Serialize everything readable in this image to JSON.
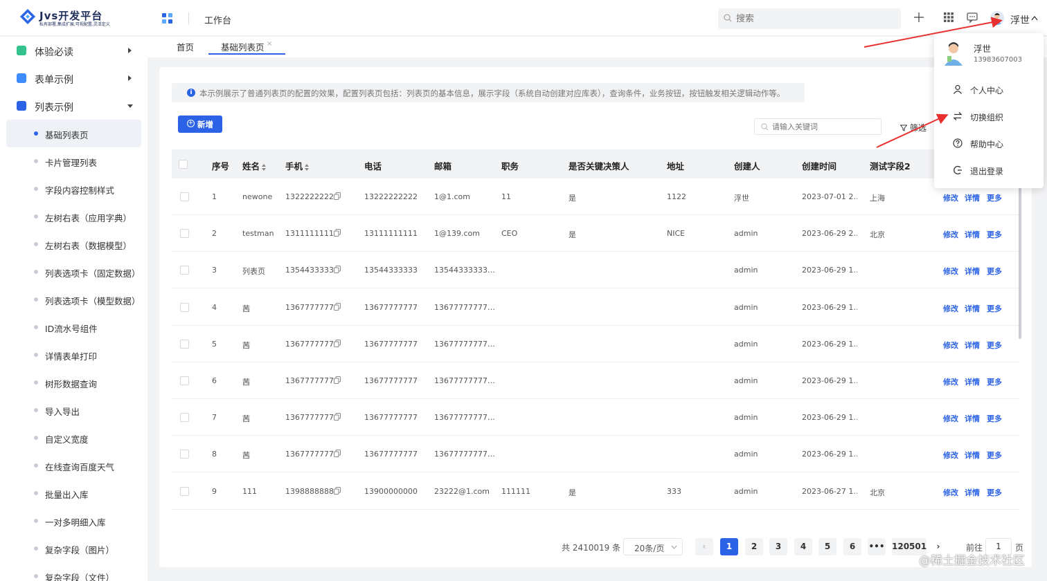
{
  "header": {
    "logo_title": "Jvs开发平台",
    "logo_subtitle": "私有部署,集成扩展,可视配置,灵活定义",
    "workspace_label": "工作台",
    "search_placeholder": "搜索",
    "user_name": "浮世"
  },
  "sidebar": {
    "groups": [
      {
        "label": "体验必读",
        "icon_color": "#34c38f",
        "expanded": false
      },
      {
        "label": "表单示例",
        "icon_color": "#3f8cff",
        "expanded": false
      },
      {
        "label": "列表示例",
        "icon_color": "#2c63e6",
        "expanded": true
      }
    ],
    "items": [
      {
        "label": "基础列表页",
        "active": true
      },
      {
        "label": "卡片管理列表"
      },
      {
        "label": "字段内容控制样式"
      },
      {
        "label": "左树右表（应用字典）"
      },
      {
        "label": "左树右表（数据模型）"
      },
      {
        "label": "列表选项卡（固定数据）"
      },
      {
        "label": "列表选项卡（模型数据）"
      },
      {
        "label": "ID流水号组件"
      },
      {
        "label": "详情表单打印"
      },
      {
        "label": "树形数据查询"
      },
      {
        "label": "导入导出"
      },
      {
        "label": "自定义宽度"
      },
      {
        "label": "在线查询百度天气"
      },
      {
        "label": "批量出入库"
      },
      {
        "label": "一对多明细入库"
      },
      {
        "label": "复杂字段（图片）"
      },
      {
        "label": "复杂字段（文件）"
      }
    ]
  },
  "tabs": [
    {
      "label": "首页"
    },
    {
      "label": "基础列表页",
      "active": true,
      "close": "×"
    }
  ],
  "notice": "本示例展示了普通列表页的配置的效果，配置列表页包括：列表页的基本信息，展示字段（系统自动创建对应库表），查询条件，业务按钮，按钮触发相关逻辑动作等。",
  "toolbar": {
    "new_label": "新增",
    "keyword_placeholder": "请输入关键词",
    "filter_label": "筛选"
  },
  "table": {
    "columns": [
      "序号",
      "姓名",
      "手机",
      "电话",
      "邮箱",
      "职务",
      "是否关键决策人",
      "地址",
      "创建人",
      "创建时间",
      "测试字段2"
    ],
    "actions": [
      "修改",
      "详情",
      "更多"
    ],
    "rows": [
      [
        "1",
        "newone",
        "13222222222",
        "13222222222",
        "1@1.com",
        "11",
        "是",
        "1122",
        "浮世",
        "2023-07-01 2…",
        "上海"
      ],
      [
        "2",
        "testman",
        "13111111111",
        "13111111111",
        "1@139.com",
        "CEO",
        "是",
        "NICE",
        "admin",
        "2023-06-29 2…",
        "北京"
      ],
      [
        "3",
        "列表页",
        "13544333333",
        "13544333333",
        "13544333333…",
        "",
        "",
        "",
        "admin",
        "2023-06-29 1…",
        ""
      ],
      [
        "4",
        "茜",
        "13677777777",
        "13677777777",
        "13677777777…",
        "",
        "",
        "",
        "admin",
        "2023-06-29 1…",
        ""
      ],
      [
        "5",
        "茜",
        "13677777777",
        "13677777777",
        "13677777777…",
        "",
        "",
        "",
        "admin",
        "2023-06-29 1…",
        ""
      ],
      [
        "6",
        "茜",
        "13677777777",
        "13677777777",
        "13677777777…",
        "",
        "",
        "",
        "admin",
        "2023-06-29 1…",
        ""
      ],
      [
        "7",
        "茜",
        "13677777777",
        "13677777777",
        "13677777777…",
        "",
        "",
        "",
        "admin",
        "2023-06-29 1…",
        ""
      ],
      [
        "8",
        "茜",
        "13677777777",
        "13677777777",
        "13677777777…",
        "",
        "",
        "",
        "admin",
        "2023-06-29 1…",
        ""
      ],
      [
        "9",
        "111",
        "13988888888",
        "13900000000",
        "23222@1.com",
        "111111",
        "是",
        "333",
        "admin",
        "2023-06-27 1…",
        "北京"
      ]
    ]
  },
  "pagination": {
    "total": "共 2410019 条",
    "page_size": "20条/页",
    "pages": [
      "1",
      "2",
      "3",
      "4",
      "5",
      "6",
      "•••",
      "120501"
    ],
    "current": "1",
    "goto_label": "前往",
    "goto_value": "1",
    "page_label": "页"
  },
  "user_menu": {
    "name": "浮世",
    "phone": "13983607003",
    "items": [
      {
        "label": "个人中心",
        "icon": "user-icon"
      },
      {
        "label": "切换组织",
        "icon": "switch-icon"
      },
      {
        "label": "帮助中心",
        "icon": "help-icon"
      },
      {
        "label": "退出登录",
        "icon": "logout-icon"
      }
    ]
  },
  "watermark": "@稀土掘金技术社区",
  "colors": {
    "primary": "#2c63e6",
    "annotation": "#e8312f"
  }
}
